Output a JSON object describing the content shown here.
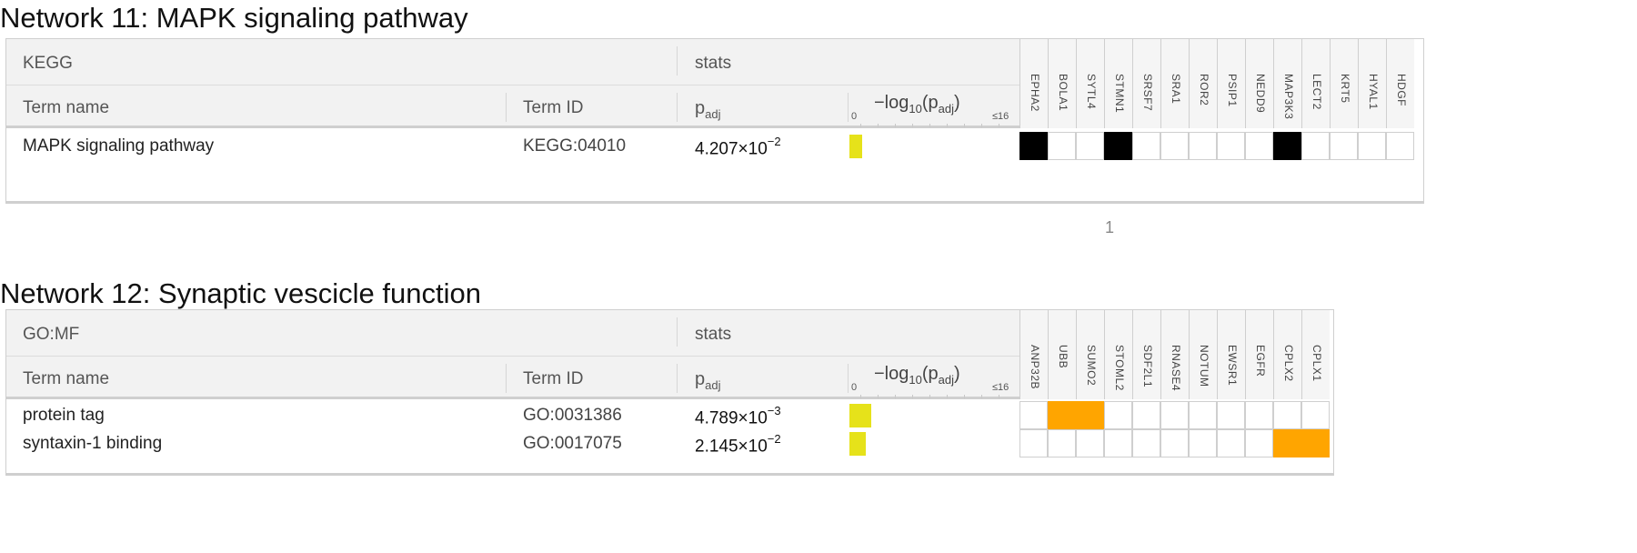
{
  "colors": {
    "black_hit": "#000000",
    "orange_hit": "#ffa500",
    "bar": "#e6e21a"
  },
  "networks": [
    {
      "title": "Network 11: MAPK signaling pathway",
      "source": "KEGG",
      "stats_label": "stats",
      "col_term": "Term name",
      "col_id": "Term ID",
      "col_padj_main": "p",
      "col_padj_sub": "adj",
      "log_main": "−log",
      "log_sub": "10",
      "log_open": "(p",
      "log_sub2": "adj",
      "log_close": ")",
      "axis_min": "0",
      "axis_max": "≤16",
      "genes": [
        "EPHA2",
        "BOLA1",
        "SYTL4",
        "STMN1",
        "SRSF7",
        "SRA1",
        "ROR2",
        "PSIP1",
        "NEDD9",
        "MAP3K3",
        "LECT2",
        "KRT5",
        "HYAL1",
        "HDGF"
      ],
      "rows": [
        {
          "term": "MAPK signaling pathway",
          "id": "KEGG:04010",
          "p_mant": "4.207×10",
          "p_exp": "−2",
          "neglog10": 1.376,
          "hits": [
            1,
            0,
            0,
            1,
            0,
            0,
            0,
            0,
            0,
            1,
            0,
            0,
            0,
            0
          ],
          "hit_color": "black"
        }
      ]
    },
    {
      "title": "Network 12: Synaptic vescicle function",
      "source": "GO:MF",
      "stats_label": "stats",
      "col_term": "Term name",
      "col_id": "Term ID",
      "col_padj_main": "p",
      "col_padj_sub": "adj",
      "log_main": "−log",
      "log_sub": "10",
      "log_open": "(p",
      "log_sub2": "adj",
      "log_close": ")",
      "axis_min": "0",
      "axis_max": "≤16",
      "genes": [
        "ANP32B",
        "UBB",
        "SUMO2",
        "STOML2",
        "SDF2L1",
        "RNASE4",
        "NOTUM",
        "EWSR1",
        "EGFR",
        "CPLX2",
        "CPLX1"
      ],
      "rows": [
        {
          "term": "protein tag",
          "id": "GO:0031386",
          "p_mant": "4.789×10",
          "p_exp": "−3",
          "neglog10": 2.32,
          "hits": [
            0,
            1,
            1,
            0,
            0,
            0,
            0,
            0,
            0,
            0,
            0
          ],
          "hit_color": "orange"
        },
        {
          "term": "syntaxin-1 binding",
          "id": "GO:0017075",
          "p_mant": "2.145×10",
          "p_exp": "−2",
          "neglog10": 1.669,
          "hits": [
            0,
            0,
            0,
            0,
            0,
            0,
            0,
            0,
            0,
            1,
            1
          ],
          "hit_color": "orange"
        }
      ]
    }
  ],
  "page_number": "1"
}
